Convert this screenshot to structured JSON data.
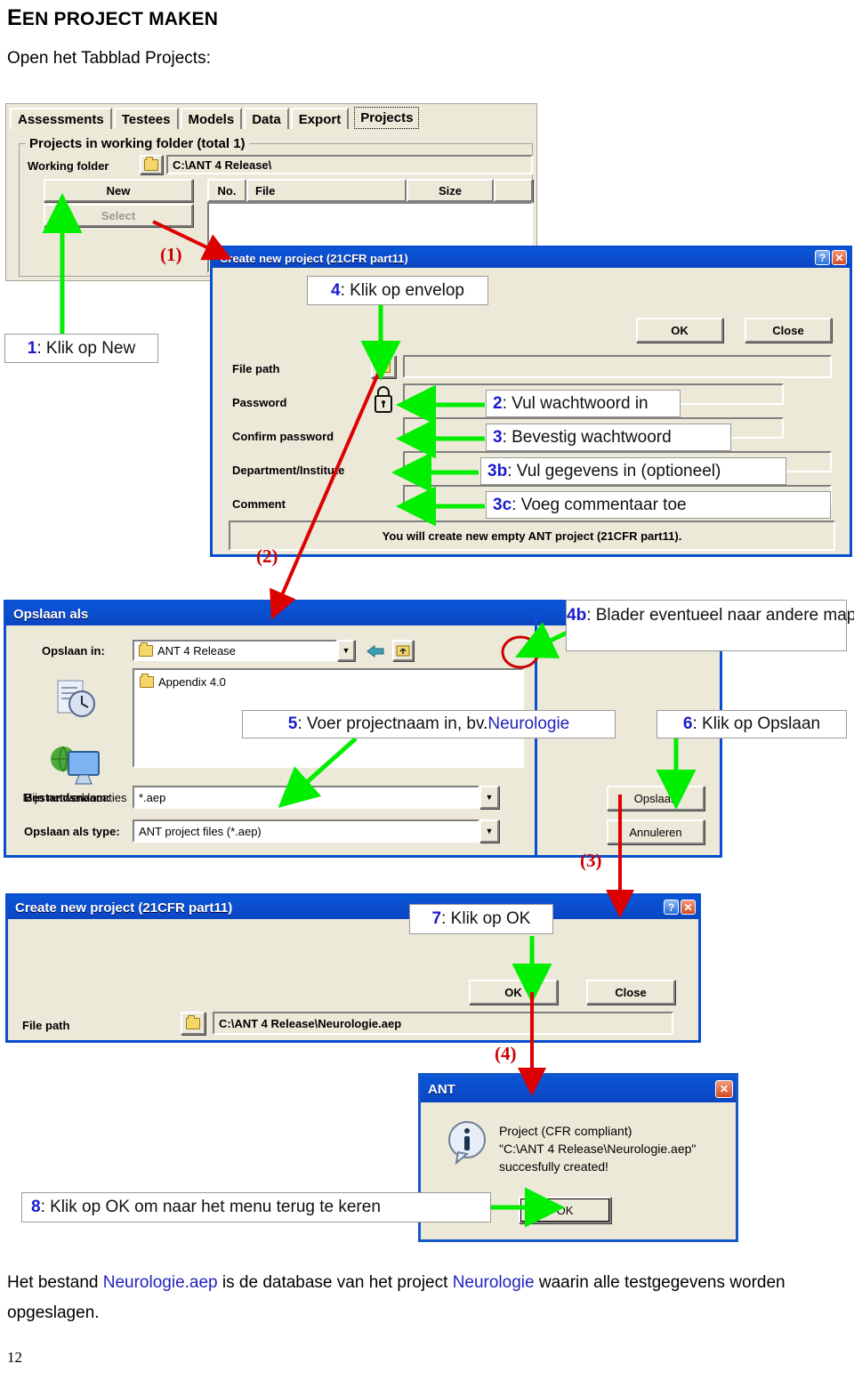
{
  "document": {
    "heading": "EEN PROJECT MAKEN",
    "heading_cap": "E",
    "heading_rest": "EN PROJECT MAKEN",
    "intro": "Open het Tabblad Projects:",
    "closing_a": "Het bestand ",
    "closing_b": "Neurologie.aep",
    "closing_c": " is de database van het project ",
    "closing_d": "Neurologie",
    "closing_e": " waarin alle testgegevens worden opgeslagen.",
    "page_number": "12"
  },
  "main_window": {
    "tabs": [
      {
        "label": "Assessments",
        "selected": false
      },
      {
        "label": "Testees",
        "selected": false
      },
      {
        "label": "Models",
        "selected": false
      },
      {
        "label": "Data",
        "selected": false
      },
      {
        "label": "Export",
        "selected": false
      },
      {
        "label": "Projects",
        "selected": true
      }
    ],
    "group_title": "Projects in working folder (total 1)",
    "working_folder_label": "Working folder",
    "working_folder_value": "C:\\ANT 4 Release\\",
    "new_button": "New",
    "select_button": "Select",
    "columns": [
      "No.",
      "File",
      "Size"
    ]
  },
  "dialog_create_new": {
    "title": "Create new project (21CFR part11)",
    "ok_button": "OK",
    "close_button": "Close",
    "labels": {
      "file_path": "File path",
      "password": "Password",
      "confirm_password": "Confirm password",
      "department": "Department/Institute",
      "comment": "Comment"
    },
    "values": {
      "file_path": "",
      "password": "",
      "confirm_password": "",
      "department": "",
      "comment": ""
    },
    "status_text": "You will create new empty ANT project (21CFR part11)."
  },
  "dialog_save_as": {
    "title": "Opslaan als",
    "save_in_label": "Opslaan in:",
    "save_in_value": "ANT 4 Release",
    "file_list": [
      "Appendix 4.0"
    ],
    "filename_label": "Bestandsnaam:",
    "filename_value": "*.aep",
    "filetype_label": "Opslaan als type:",
    "filetype_value": "ANT project files (*.aep)",
    "save_button": "Opslaan",
    "cancel_button": "Annuleren",
    "places": [
      {
        "label": "",
        "icon": "recent-documents-icon"
      },
      {
        "label": "Mijn netwerklocaties",
        "icon": "network-places-icon"
      }
    ]
  },
  "dialog_create_filled": {
    "title": "Create new project (21CFR part11)",
    "ok_button": "OK",
    "close_button": "Close",
    "file_path_label": "File path",
    "file_path_value": "C:\\ANT 4 Release\\Neurologie.aep"
  },
  "dialog_ant": {
    "title": "ANT",
    "message": "Project (CFR compliant)\n\"C:\\ANT 4 Release\\Neurologie.aep\"\nsuccesfully created!",
    "ok_button": "OK"
  },
  "callouts": [
    {
      "id": "1",
      "num": "1",
      "text": ": Klik op New"
    },
    {
      "id": "2",
      "num": "2",
      "text": ": Vul wachtwoord in"
    },
    {
      "id": "3",
      "num": "3",
      "text": ": Bevestig wachtwoord"
    },
    {
      "id": "3b",
      "num": "3b",
      "text": ": Vul gegevens in (optioneel)"
    },
    {
      "id": "3c",
      "num": "3c",
      "text": ": Voeg commentaar toe"
    },
    {
      "id": "4",
      "num": "4",
      "text": ": Klik op envelop"
    },
    {
      "id": "4b",
      "num": "4b",
      "text": ": Blader eventueel naar andere map"
    },
    {
      "id": "5",
      "num": "5",
      "text": ": Voer projectnaam in, bv. ",
      "highlight": "Neurologie"
    },
    {
      "id": "6",
      "num": "6",
      "text": ": Klik op Opslaan"
    },
    {
      "id": "7",
      "num": "7",
      "text": ": Klik op OK"
    },
    {
      "id": "8",
      "num": "8",
      "text": ": Klik op OK om naar het menu terug te keren"
    }
  ],
  "step_markers": [
    {
      "label": "(1)"
    },
    {
      "label": "(2)"
    },
    {
      "label": "(3)"
    },
    {
      "label": "(4)"
    }
  ],
  "colors": {
    "green_arrow": "#00ee00",
    "red_arrow": "#dd0000",
    "callout_number": "#1a1ad0",
    "link_blue": "#2222bb",
    "titlebar_blue": "#0a4fd0",
    "dialog_face": "#ece9d8"
  }
}
